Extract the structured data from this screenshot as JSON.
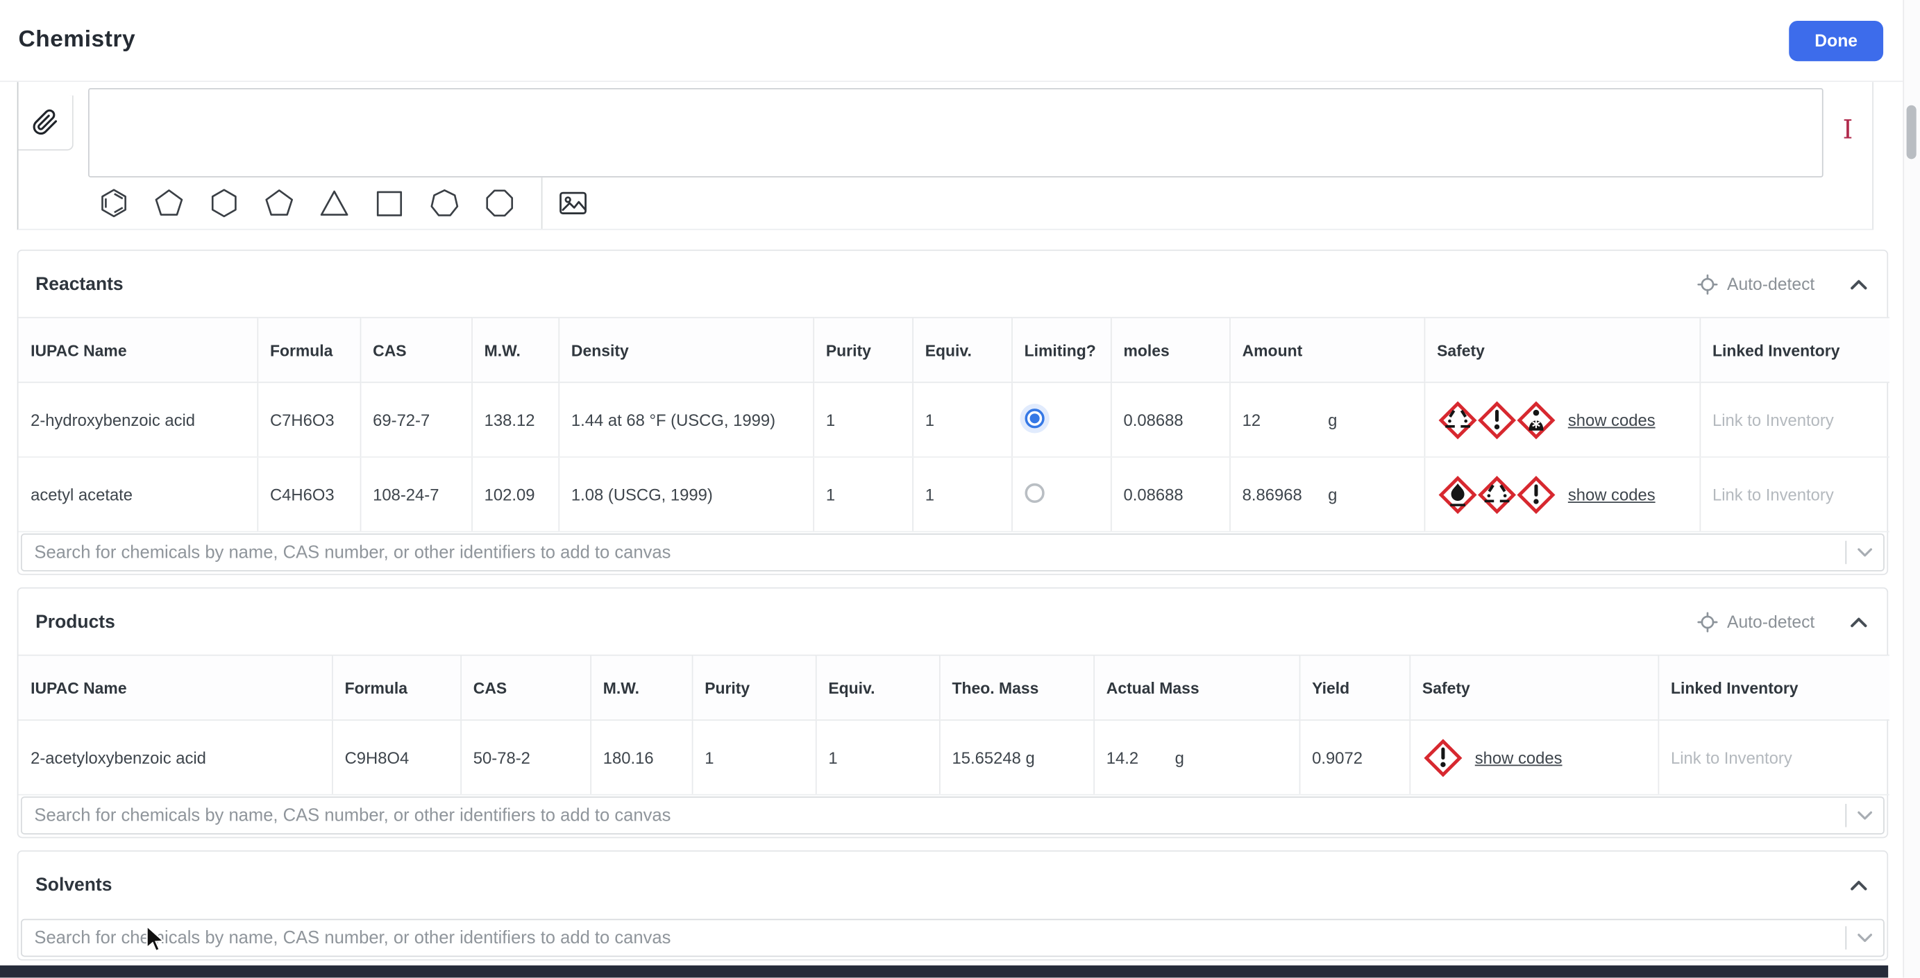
{
  "header": {
    "title": "Chemistry",
    "done_label": "Done"
  },
  "sketcher": {
    "tool_marker": "I",
    "tools": [
      "paperclip-attach",
      "benzene",
      "cyclopentadiene",
      "cyclohexane",
      "cyclopentane",
      "cyclopropane",
      "cyclobutane",
      "cycloheptane",
      "cyclooctane",
      "insert-image"
    ]
  },
  "search": {
    "placeholder": "Search for chemicals by name, CAS number, or other identifiers to add to canvas"
  },
  "reactants": {
    "title": "Reactants",
    "autodetect_label": "Auto-detect",
    "columns": [
      "IUPAC Name",
      "Formula",
      "CAS",
      "M.W.",
      "Density",
      "Purity",
      "Equiv.",
      "Limiting?",
      "moles",
      "Amount",
      "Safety",
      "Linked Inventory"
    ],
    "show_codes_label": "show codes",
    "link_inventory_label": "Link to Inventory",
    "rows": [
      {
        "iupac": "2-hydroxybenzoic acid",
        "formula": "C7H6O3",
        "cas": "69-72-7",
        "mw": "138.12",
        "density": "1.44 at 68 °F (USCG, 1999)",
        "purity": "1",
        "equiv": "1",
        "limiting": true,
        "moles": "0.08688",
        "amount": "12",
        "amount_unit": "g",
        "pictograms": [
          "corrosion",
          "exclamation",
          "health-hazard"
        ]
      },
      {
        "iupac": "acetyl acetate",
        "formula": "C4H6O3",
        "cas": "108-24-7",
        "mw": "102.09",
        "density": "1.08 (USCG, 1999)",
        "purity": "1",
        "equiv": "1",
        "limiting": false,
        "moles": "0.08688",
        "amount": "8.86968",
        "amount_unit": "g",
        "pictograms": [
          "flame",
          "corrosion",
          "exclamation"
        ]
      }
    ]
  },
  "products": {
    "title": "Products",
    "autodetect_label": "Auto-detect",
    "columns": [
      "IUPAC Name",
      "Formula",
      "CAS",
      "M.W.",
      "Purity",
      "Equiv.",
      "Theo. Mass",
      "Actual Mass",
      "Yield",
      "Safety",
      "Linked Inventory"
    ],
    "show_codes_label": "show codes",
    "link_inventory_label": "Link to Inventory",
    "rows": [
      {
        "iupac": "2-acetyloxybenzoic acid",
        "formula": "C9H8O4",
        "cas": "50-78-2",
        "mw": "180.16",
        "purity": "1",
        "equiv": "1",
        "theo_mass": "15.65248 g",
        "actual_mass": "14.2",
        "actual_unit": "g",
        "yield": "0.9072",
        "pictograms": [
          "exclamation"
        ]
      }
    ]
  },
  "solvents": {
    "title": "Solvents"
  },
  "colors": {
    "accent_blue": "#3d6ceb",
    "ghs_red": "#d7282f",
    "bottom_bar": "#262c3a"
  }
}
